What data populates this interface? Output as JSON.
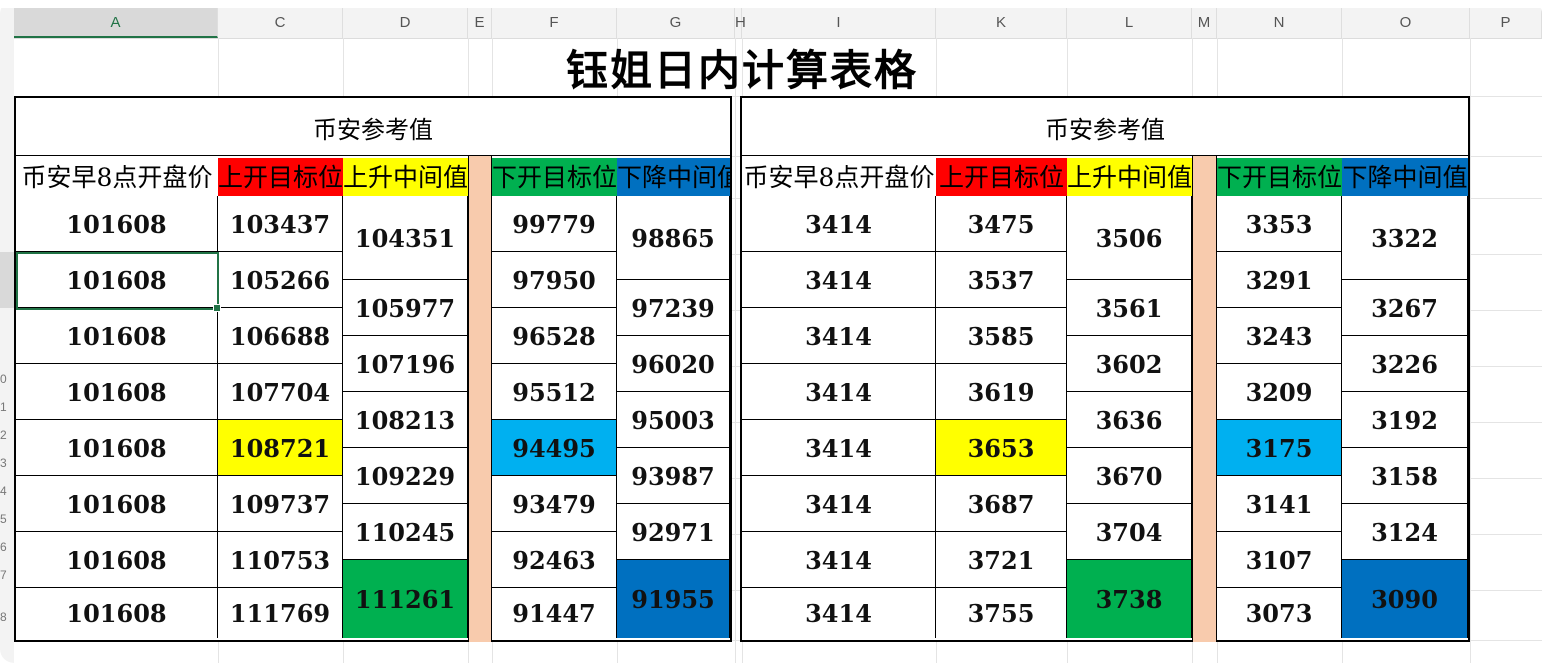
{
  "sheet": {
    "columns": [
      "A",
      "C",
      "D",
      "E",
      "F",
      "G",
      "H",
      "I",
      "K",
      "L",
      "M",
      "N",
      "O",
      "P"
    ],
    "row_numbers": [
      "0",
      "1",
      "2",
      "3",
      "4",
      "5",
      "6",
      "7",
      "8"
    ]
  },
  "title": "钰姐日内计算表格",
  "panels": [
    {
      "title": "币安参考值",
      "headers": [
        "币安早8点开盘价",
        "上开目标位",
        "上升中间值",
        "下开目标位",
        "下降中间值"
      ],
      "open": [
        "101608",
        "101608",
        "101608",
        "101608",
        "101608",
        "101608",
        "101608",
        "101608"
      ],
      "up_target": [
        "103437",
        "105266",
        "106688",
        "107704",
        "108721",
        "109737",
        "110753",
        "111769"
      ],
      "up_mid": [
        "104351",
        "105977",
        "107196",
        "108213",
        "109229",
        "110245",
        "111261"
      ],
      "down_target": [
        "99779",
        "97950",
        "96528",
        "95512",
        "94495",
        "93479",
        "92463",
        "91447"
      ],
      "down_mid": [
        "98865",
        "97239",
        "96020",
        "95003",
        "93987",
        "92971",
        "91955"
      ]
    },
    {
      "title": "币安参考值",
      "headers": [
        "币安早8点开盘价",
        "上开目标位",
        "上升中间值",
        "下开目标位",
        "下降中间值"
      ],
      "open": [
        "3414",
        "3414",
        "3414",
        "3414",
        "3414",
        "3414",
        "3414",
        "3414"
      ],
      "up_target": [
        "3475",
        "3537",
        "3585",
        "3619",
        "3653",
        "3687",
        "3721",
        "3755"
      ],
      "up_mid": [
        "3506",
        "3561",
        "3602",
        "3636",
        "3670",
        "3704",
        "3738"
      ],
      "down_target": [
        "3353",
        "3291",
        "3243",
        "3209",
        "3175",
        "3141",
        "3107",
        "3073"
      ],
      "down_mid": [
        "3322",
        "3267",
        "3226",
        "3192",
        "3158",
        "3124",
        "3090"
      ]
    }
  ],
  "colors": {
    "red_header": "#ff0000",
    "yellow_header": "#ffff00",
    "green_header": "#00b050",
    "blue_header": "#0070c0",
    "highlight_yellow": "#ffff00",
    "highlight_cyan": "#00b0f0",
    "highlight_green": "#00b050",
    "highlight_blue": "#0070c0",
    "separator": "#f8cbad",
    "selection": "#217346"
  }
}
